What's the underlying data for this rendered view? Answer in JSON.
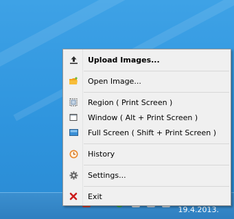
{
  "menu": {
    "items": [
      {
        "label": "Upload Images...",
        "icon": "upload-icon",
        "bold": true
      },
      {
        "label": "Open Image...",
        "icon": "folder-icon"
      },
      {
        "label": "Region ( Print Screen )",
        "icon": "region-icon"
      },
      {
        "label": "Window ( Alt + Print Screen )",
        "icon": "window-icon"
      },
      {
        "label": "Full Screen ( Shift + Print Screen )",
        "icon": "fullscreen-icon"
      },
      {
        "label": "History",
        "icon": "history-icon"
      },
      {
        "label": "Settings...",
        "icon": "gear-icon"
      },
      {
        "label": "Exit",
        "icon": "close-icon"
      }
    ]
  },
  "taskbar": {
    "clock_date": "19.4.2013."
  },
  "colors": {
    "desktop": "#2f95de",
    "menu_bg": "#f0f0f0",
    "exit_icon": "#cc1b1b",
    "folder_icon": "#f2a51a",
    "history_icon": "#e8862a"
  }
}
